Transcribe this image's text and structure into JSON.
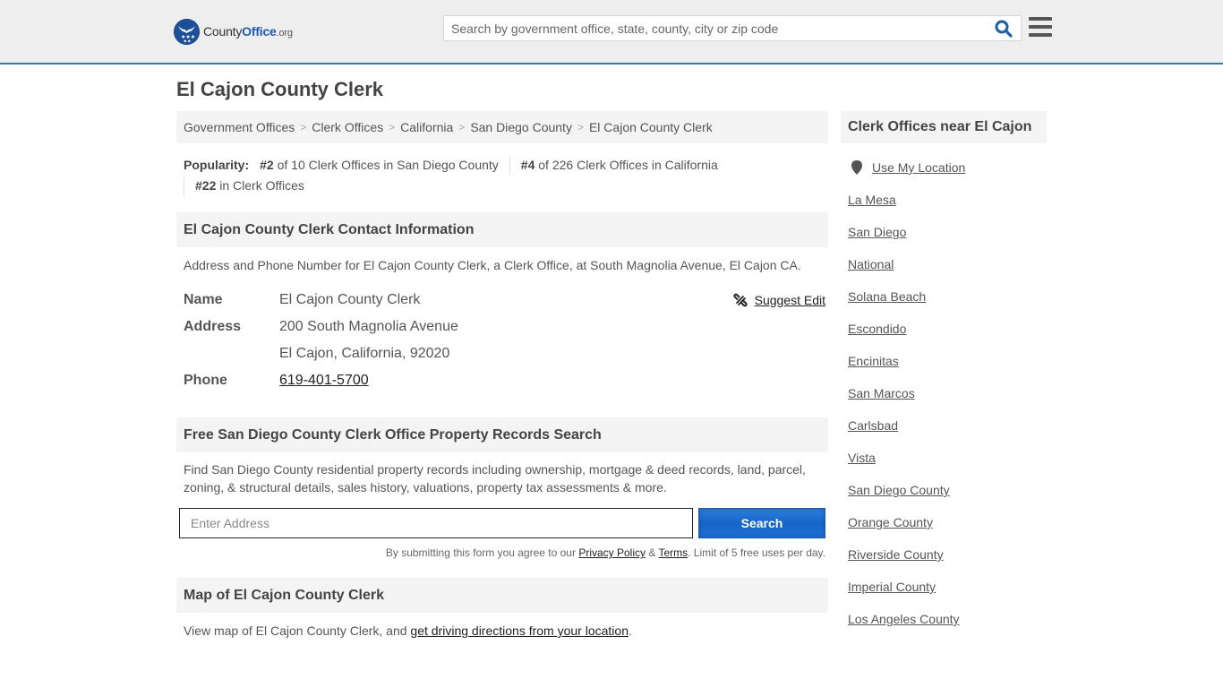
{
  "header": {
    "logo": {
      "brand_main": "County",
      "brand_accent": "Office",
      "brand_tld": ".org"
    },
    "search": {
      "placeholder": "Search by government office, state, county, city or zip code",
      "value": ""
    },
    "icons": {
      "search": "search-icon",
      "menu": "hamburger-menu-icon"
    },
    "colors": {
      "accent": "#2f78b7",
      "logo_blue": "#1e4f96"
    }
  },
  "page": {
    "title": "El Cajon County Clerk"
  },
  "breadcrumb": [
    {
      "label": "Government Offices"
    },
    {
      "label": "Clerk Offices"
    },
    {
      "label": "California"
    },
    {
      "label": "San Diego County"
    },
    {
      "label": "El Cajon County Clerk"
    }
  ],
  "popularity": {
    "label": "Popularity:",
    "items": [
      {
        "rank": "#2",
        "text": " of 10 Clerk Offices in San Diego County"
      },
      {
        "rank": "#4",
        "text": " of 226 Clerk Offices in California"
      },
      {
        "rank": "#22",
        "text": " in Clerk Offices"
      }
    ]
  },
  "contact": {
    "heading": "El Cajon County Clerk Contact Information",
    "description": "Address and Phone Number for El Cajon County Clerk, a Clerk Office, at South Magnolia Avenue, El Cajon CA.",
    "suggest_edit": "Suggest Edit",
    "rows": {
      "name_label": "Name",
      "name_value": "El Cajon County Clerk",
      "address_label": "Address",
      "address_line1": "200 South Magnolia Avenue",
      "address_line2": "El Cajon, California, 92020",
      "phone_label": "Phone",
      "phone_value": "619-401-5700"
    }
  },
  "property_search": {
    "heading": "Free San Diego County Clerk Office Property Records Search",
    "description": "Find San Diego County residential property records including ownership, mortgage & deed records, land, parcel, zoning, & structural details, sales history, valuations, property tax assessments & more.",
    "input_placeholder": "Enter Address",
    "input_value": "",
    "button_label": "Search",
    "button_color": "#1666c9",
    "disclaimer": {
      "prefix": "By submitting this form you agree to our ",
      "privacy": "Privacy Policy",
      "amp": " & ",
      "terms": "Terms",
      "suffix": ". Limit of 5 free uses per day."
    }
  },
  "map": {
    "heading": "Map of El Cajon County Clerk",
    "desc_prefix": "View map of El Cajon County Clerk, and ",
    "desc_link": "get driving directions from your location",
    "desc_suffix": "."
  },
  "sidebar": {
    "heading": "Clerk Offices near El Cajon",
    "use_location": "Use My Location",
    "items": [
      {
        "label": "La Mesa"
      },
      {
        "label": "San Diego"
      },
      {
        "label": "National"
      },
      {
        "label": "Solana Beach"
      },
      {
        "label": "Escondido"
      },
      {
        "label": "Encinitas"
      },
      {
        "label": "San Marcos"
      },
      {
        "label": "Carlsbad"
      },
      {
        "label": "Vista"
      },
      {
        "label": "San Diego County"
      },
      {
        "label": "Orange County"
      },
      {
        "label": "Riverside County"
      },
      {
        "label": "Imperial County"
      },
      {
        "label": "Los Angeles County"
      }
    ]
  }
}
